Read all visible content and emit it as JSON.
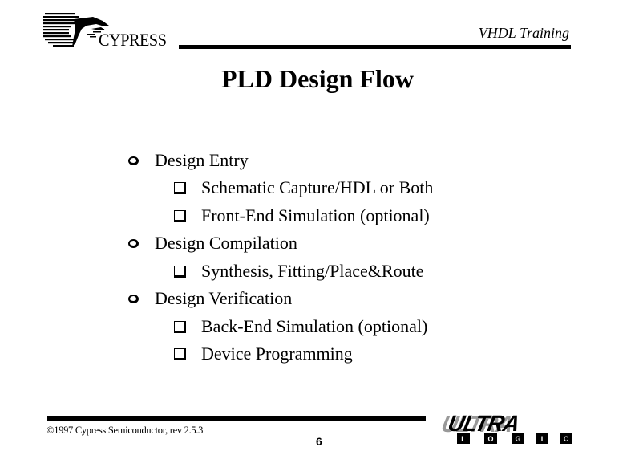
{
  "header": {
    "company": "CYPRESS",
    "label": "VHDL Training"
  },
  "slide": {
    "title": "PLD Design Flow",
    "bullets": [
      {
        "level": 1,
        "text": "Design Entry"
      },
      {
        "level": 2,
        "text": "Schematic Capture/HDL or Both"
      },
      {
        "level": 2,
        "text": "Front-End Simulation (optional)"
      },
      {
        "level": 1,
        "text": "Design Compilation"
      },
      {
        "level": 2,
        "text": "Synthesis, Fitting/Place&Route"
      },
      {
        "level": 1,
        "text": "Design Verification"
      },
      {
        "level": 2,
        "text": "Back-End Simulation (optional)"
      },
      {
        "level": 2,
        "text": "Device Programming"
      }
    ]
  },
  "footer": {
    "copyright": "©1997 Cypress Semiconductor, rev 2.5.3",
    "page_number": "6",
    "brand_main": "ULTRA",
    "brand_sub": [
      "L",
      "O",
      "G",
      "I",
      "C"
    ]
  }
}
